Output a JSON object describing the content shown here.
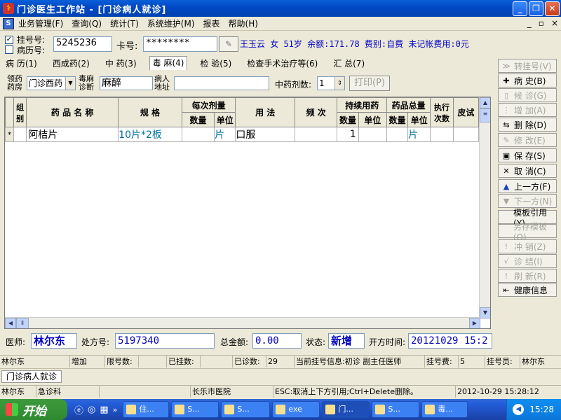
{
  "window": {
    "title": "门诊医生工作站 - [门诊病人就诊]",
    "app_icon": "caduceus-icon",
    "buttons": [
      "_",
      "❐",
      "✕"
    ]
  },
  "menu": {
    "items": [
      "业务管理(F)",
      "查询(Q)",
      "统计(T)",
      "系统维护(M)",
      "报表",
      "帮助(H)"
    ],
    "mdi_controls": [
      "_",
      "▫",
      "×"
    ]
  },
  "patient": {
    "reg_label": "挂号号:",
    "chart_label": "病历号:",
    "reg_checked": true,
    "reg_number": "5245236",
    "card_label": "卡号:",
    "card_number": "********",
    "info": "王玉云 女 51岁 余额:171.78 费别:自费 未记帐费用:0元"
  },
  "tabs": [
    "病 历(1)",
    "西成药(2)",
    "中 药(3)",
    "毒 麻(4)",
    "检 验(5)",
    "检查手术治疗等(6)",
    "汇 总(7)"
  ],
  "active_tab": 3,
  "subbar": {
    "pharmacy_label": [
      "领药",
      "药房"
    ],
    "pharmacy_value": "门诊西药",
    "diagnosis_label": [
      "毒麻",
      "诊断"
    ],
    "diagnosis_value": "麻醉",
    "address_label": [
      "病人",
      "地址"
    ],
    "address_value": "",
    "herb_count_label": "中药剂数:",
    "herb_count_value": "1",
    "print_button": "打印(P)"
  },
  "grid": {
    "headers": {
      "group": "组别",
      "drug_name": "药 品 名 称",
      "spec": "规  格",
      "dose": "每次剂量",
      "usage": "用  法",
      "freq": "频  次",
      "duration": "持续用药",
      "total": "药品总量",
      "exec_times": "执行次数",
      "skin_test": "皮试",
      "qty": "数量",
      "unit": "单位"
    },
    "rows": [
      {
        "marker": "*",
        "group": "",
        "drug_name": "阿桔片",
        "spec": "10片*2板",
        "dose_qty": "",
        "dose_unit": "片",
        "usage": "口服",
        "freq": "",
        "dur_qty": "1",
        "dur_unit": "",
        "total_qty": "",
        "total_unit": "片",
        "exec": "",
        "skin": ""
      }
    ]
  },
  "right_buttons": [
    {
      "label": "转挂号(V)",
      "icon": "double-chevron-icon",
      "glyph": "≫",
      "enabled": false
    },
    {
      "label": "病 史(B)",
      "icon": "plus-icon",
      "glyph": "✚",
      "enabled": true
    },
    {
      "label": "候 诊(G)",
      "icon": "document-icon",
      "glyph": "▯",
      "enabled": false
    },
    {
      "label": "增 加(A)",
      "icon": "add-row-icon",
      "glyph": "⋮",
      "enabled": false
    },
    {
      "label": "删 除(D)",
      "icon": "delete-row-icon",
      "glyph": "⇆",
      "enabled": true
    },
    {
      "label": "修 改(E)",
      "icon": "edit-icon",
      "glyph": "✎",
      "enabled": false
    },
    {
      "label": "保 存(S)",
      "icon": "save-icon",
      "glyph": "▣",
      "enabled": true
    },
    {
      "label": "取 消(C)",
      "icon": "cancel-icon",
      "glyph": "✕",
      "enabled": true
    },
    {
      "label": "上一方(F)",
      "icon": "up-arrow-icon",
      "glyph": "▲",
      "enabled": true
    },
    {
      "label": "下一方(N)",
      "icon": "down-arrow-icon",
      "glyph": "▼",
      "enabled": false
    },
    {
      "label": "模板引用(Y)",
      "icon": "",
      "glyph": "",
      "enabled": true
    },
    {
      "label": "另存模板(O)",
      "icon": "",
      "glyph": "",
      "enabled": false
    },
    {
      "label": "冲 销(Z)",
      "icon": "exclaim-icon",
      "glyph": "!",
      "enabled": false
    },
    {
      "label": "诊 结(I)",
      "icon": "check-icon",
      "glyph": "√",
      "enabled": false
    },
    {
      "label": "刷 新(R)",
      "icon": "exclaim-icon",
      "glyph": "!",
      "enabled": false
    },
    {
      "label": "健康信息",
      "icon": "health-info-icon",
      "glyph": "⇤",
      "enabled": true
    }
  ],
  "footer": {
    "doctor_label": "医师:",
    "doctor_value": "林尔东",
    "rx_label": "处方号:",
    "rx_value": "5197340",
    "total_label": "总金额:",
    "total_value": "0.00",
    "state_label": "状态:",
    "state_value": "新增",
    "time_label": "开方时间:",
    "time_value": "20121029 15:2"
  },
  "status1": [
    "林尔东",
    "增加",
    "限号数:",
    "",
    "已挂数:",
    "",
    "已诊数:",
    "29",
    "当前挂号信息:初诊 副主任医师",
    "挂号费:",
    "5",
    "挂号员:",
    "林尔东"
  ],
  "mdi_tab": "门诊病人就诊",
  "status2": [
    "林尔东",
    "急诊科",
    "",
    "长乐市医院",
    "ESC:取消上下方引用;Ctrl+Delete删除。",
    "2012-10-29 15:28:12"
  ],
  "taskbar": {
    "start": "开始",
    "tasks": [
      "住...",
      "S...",
      "S...",
      "exe",
      "门...",
      "S...",
      "毒..."
    ],
    "clock": "15:28"
  }
}
